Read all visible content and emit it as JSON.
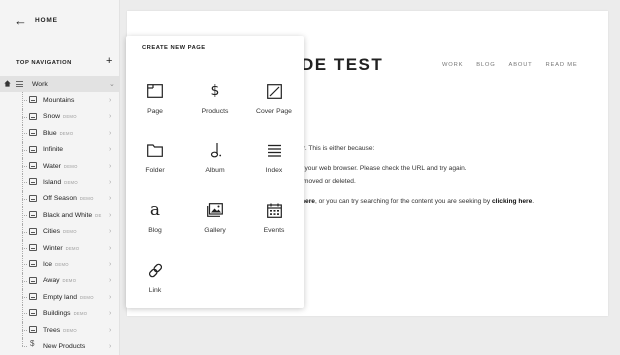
{
  "sidebar": {
    "home_label": "HOME",
    "top_navigation_label": "TOP NAVIGATION",
    "folder": {
      "name": "Work"
    },
    "items": [
      {
        "name": "Mountains",
        "badge": "",
        "icon": "page-icon"
      },
      {
        "name": "Snow",
        "badge": "DEMO",
        "icon": "page-icon"
      },
      {
        "name": "Blue",
        "badge": "DEMO",
        "icon": "page-icon"
      },
      {
        "name": "Infinite",
        "badge": "",
        "icon": "page-icon"
      },
      {
        "name": "Water",
        "badge": "DEMO",
        "icon": "page-icon"
      },
      {
        "name": "Island",
        "badge": "DEMO",
        "icon": "page-icon"
      },
      {
        "name": "Off Season",
        "badge": "DEMO",
        "icon": "page-icon"
      },
      {
        "name": "Black and White",
        "badge": "DE",
        "icon": "page-icon"
      },
      {
        "name": "Cities",
        "badge": "DEMO",
        "icon": "page-icon"
      },
      {
        "name": "Winter",
        "badge": "DEMO",
        "icon": "page-icon"
      },
      {
        "name": "Ice",
        "badge": "DEMO",
        "icon": "page-icon"
      },
      {
        "name": "Away",
        "badge": "DEMO",
        "icon": "page-icon"
      },
      {
        "name": "Empty land",
        "badge": "DEMO",
        "icon": "page-icon"
      },
      {
        "name": "Buildings",
        "badge": "DEMO",
        "icon": "page-icon"
      },
      {
        "name": "Trees",
        "badge": "DEMO",
        "icon": "page-icon"
      },
      {
        "name": "New Products",
        "badge": "",
        "icon": "dollar-icon"
      }
    ]
  },
  "preview": {
    "site_title": "DE TEST",
    "nav": [
      "WORK",
      "BLOG",
      "ABOUT",
      "READ ME"
    ],
    "lines": {
      "l1": "r. This is either because:",
      "l2": "o your web browser. Please check the URL and try again.",
      "l3": "moved or deleted.",
      "l4_pre": "here",
      "l4_mid": ", or you can try searching for the content you are seeking by ",
      "l4_link": "clicking here",
      "l4_end": "."
    }
  },
  "popup": {
    "title": "CREATE NEW PAGE",
    "tiles": [
      {
        "label": "Page",
        "icon": "page-icon"
      },
      {
        "label": "Products",
        "icon": "dollar-icon"
      },
      {
        "label": "Cover Page",
        "icon": "cover-page-icon"
      },
      {
        "label": "Folder",
        "icon": "folder-icon"
      },
      {
        "label": "Album",
        "icon": "music-note-icon"
      },
      {
        "label": "Index",
        "icon": "index-list-icon"
      },
      {
        "label": "Blog",
        "icon": "blog-icon"
      },
      {
        "label": "Gallery",
        "icon": "gallery-icon"
      },
      {
        "label": "Events",
        "icon": "calendar-icon"
      },
      {
        "label": "Link",
        "icon": "link-icon"
      }
    ]
  }
}
